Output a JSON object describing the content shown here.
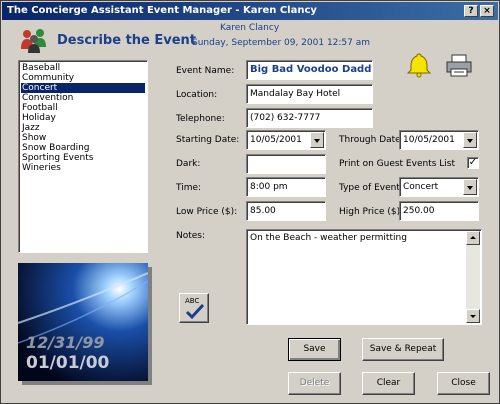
{
  "window": {
    "title": "The Concierge Assistant Event Manager - Karen Clancy",
    "controls": {
      "help": "?",
      "close": "×"
    }
  },
  "header": {
    "heading": "Describe the Event",
    "user": "Karen Clancy",
    "datetime": "Sunday,  September 09, 2001    12:57 am",
    "accent_color": "#1b3f8b"
  },
  "categories": {
    "items": [
      "Baseball",
      "Community",
      "Concert",
      "Convention",
      "Football",
      "Holiday",
      "Jazz",
      "Show",
      "Snow Boarding",
      "Sporting Events",
      "Wineries"
    ],
    "selected": "Concert"
  },
  "form": {
    "event_name_label": "Event Name:",
    "event_name_value": "Big Bad Voodoo Daddy",
    "location_label": "Location:",
    "location_value": "Mandalay Bay Hotel",
    "telephone_label": "Telephone:",
    "telephone_value": "(702) 632-7777",
    "starting_date_label": "Starting Date:",
    "starting_date_value": "10/05/2001",
    "through_date_label": "Through Date:",
    "through_date_value": "10/05/2001",
    "dark_label": "Dark:",
    "dark_value": "",
    "print_guest_label": "Print on Guest Events List",
    "print_guest_checked": "✓",
    "time_label": "Time:",
    "time_value": "8:00 pm",
    "type_label": "Type of Event:",
    "type_value": "Concert",
    "low_price_label": "Low Price ($):",
    "low_price_value": "85.00",
    "high_price_label": "High Price ($):",
    "high_price_value": "250.00",
    "notes_label": "Notes:",
    "notes_value": "On the Beach - weather permitting"
  },
  "promo_image": {
    "date_old": "12/31/99",
    "date_new": "01/01/00"
  },
  "spellcheck": {
    "label": "ABC"
  },
  "buttons": {
    "save": "Save",
    "save_repeat": "Save & Repeat",
    "delete": "Delete",
    "clear": "Clear",
    "close": "Close"
  },
  "icons": {
    "bell": "bell-icon",
    "printer": "printer-icon",
    "people": "people-icon",
    "spellcheck": "spellcheck-icon"
  }
}
